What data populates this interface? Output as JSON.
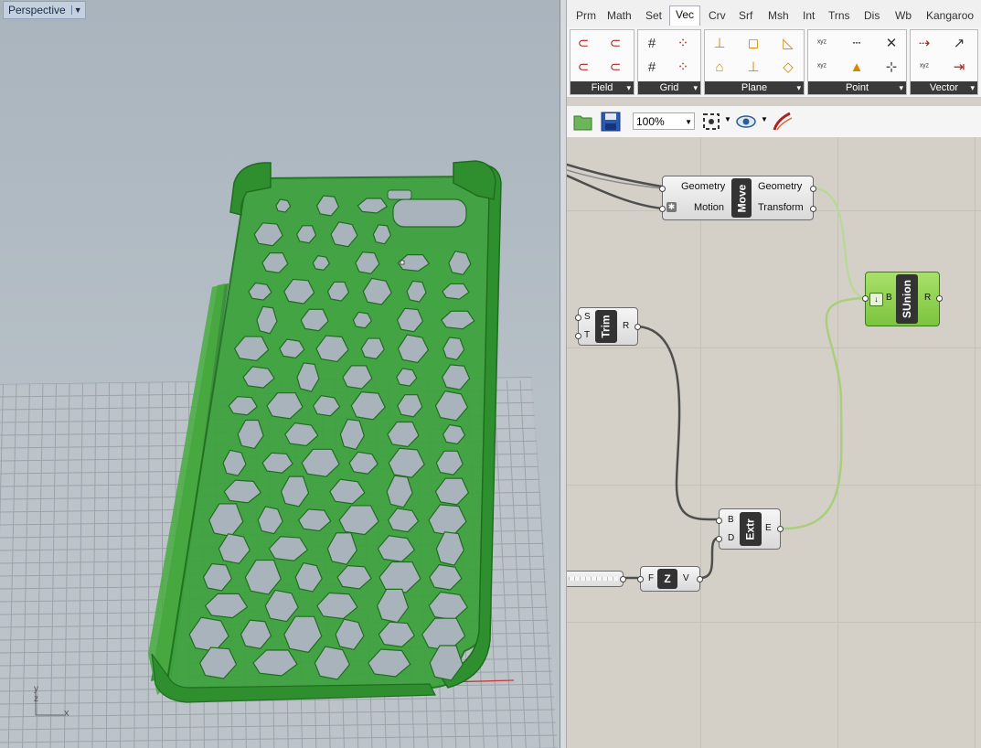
{
  "viewport": {
    "label": "Perspective",
    "axes": {
      "y": "y",
      "z": "z",
      "x": "x"
    }
  },
  "tabs": [
    "Prm",
    "Math",
    "Set",
    "Vec",
    "Crv",
    "Srf",
    "Msh",
    "Int",
    "Trns",
    "Dis",
    "Wb",
    "Kangaroo"
  ],
  "active_tab": "Vec",
  "groups": [
    "Field",
    "Grid",
    "Plane",
    "Point",
    "Vector"
  ],
  "toolbar": {
    "zoom": "100%"
  },
  "components": {
    "move": {
      "nickname": "Move",
      "inputs": [
        "Geometry",
        "Motion"
      ],
      "outputs": [
        "Geometry",
        "Transform"
      ]
    },
    "trim": {
      "nickname": "Trim",
      "inputs": [
        "S",
        "T"
      ],
      "outputs": [
        "R"
      ]
    },
    "sunion": {
      "nickname": "SUnion",
      "inputs": [
        "B"
      ],
      "outputs": [
        "R"
      ]
    },
    "extr": {
      "nickname": "Extr",
      "inputs": [
        "B",
        "D"
      ],
      "outputs": [
        "E"
      ]
    },
    "unitz": {
      "nickname": "Z",
      "inputs": [
        "F"
      ],
      "outputs": [
        "V"
      ]
    }
  },
  "colors": {
    "phone_case": "#3aa23a",
    "sunion": "#8fd14f",
    "wire": "#4e4e4e",
    "wire_selected": "#9bd15a"
  }
}
